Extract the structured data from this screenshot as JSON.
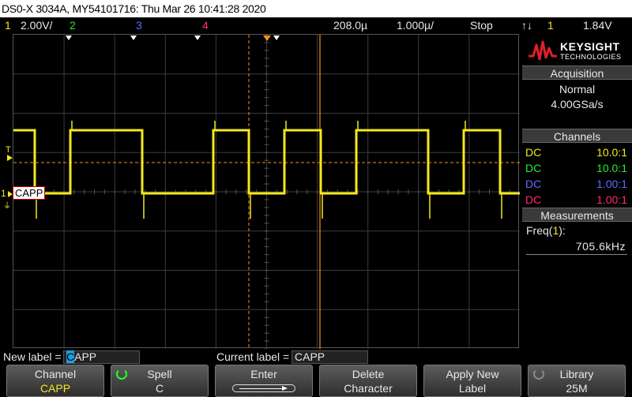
{
  "title": "DS0-X 3034A, MY54101716: Thu Mar 26 10:41:28 2020",
  "status": {
    "ch1_num": "1",
    "ch1_scale": "2.00V/",
    "ch2_num": "2",
    "ch3_num": "3",
    "ch4_num": "4",
    "delay": "208.0µ",
    "timebase": "1.000µ/",
    "run_state": "Stop",
    "trigger_icon": "trigger-edge-icon",
    "trigger_ch": "1",
    "trigger_level": "1.84V"
  },
  "waveform": {
    "ch1_marker": "1",
    "trigger_marker": "T",
    "channel_label": "CAPP"
  },
  "panel": {
    "brand": "KEYSIGHT",
    "brand_sub": "TECHNOLOGIES",
    "acquisition_head": "Acquisition",
    "acq_mode": "Normal",
    "acq_rate": "4.00GSa/s",
    "channels_head": "Channels",
    "channels": [
      {
        "coupling": "DC",
        "ratio": "10.0:1",
        "color": "#f4e81c"
      },
      {
        "coupling": "DC",
        "ratio": "10.0:1",
        "color": "#2ee82e"
      },
      {
        "coupling": "DC",
        "ratio": "1.00:1",
        "color": "#5a6cff"
      },
      {
        "coupling": "DC",
        "ratio": "1.00:1",
        "color": "#ff2a70"
      }
    ],
    "measurements_head": "Measurements",
    "meas_label": "Freq(",
    "meas_ch": "1",
    "meas_close": "):",
    "meas_value": "705.6kHz"
  },
  "label_edit": {
    "new_label_text": "New label =",
    "new_label_cursor": "C",
    "new_label_rest": "APP",
    "current_label_text": "Current label =",
    "current_label_value": "CAPP"
  },
  "softkeys": [
    {
      "title": "Channel",
      "value": "CAPP"
    },
    {
      "title": "Spell",
      "value": "C"
    },
    {
      "title": "Enter",
      "value": ""
    },
    {
      "title": "Delete",
      "value": "Character"
    },
    {
      "title": "Apply New",
      "value": "Label"
    },
    {
      "title": "Library",
      "value": "25M"
    }
  ],
  "colors": {
    "ch1": "#f4e81c",
    "ch2": "#2ee82e",
    "ch3": "#5a6cff",
    "ch4": "#ff2a70",
    "cursor": "#ff8c1a"
  }
}
